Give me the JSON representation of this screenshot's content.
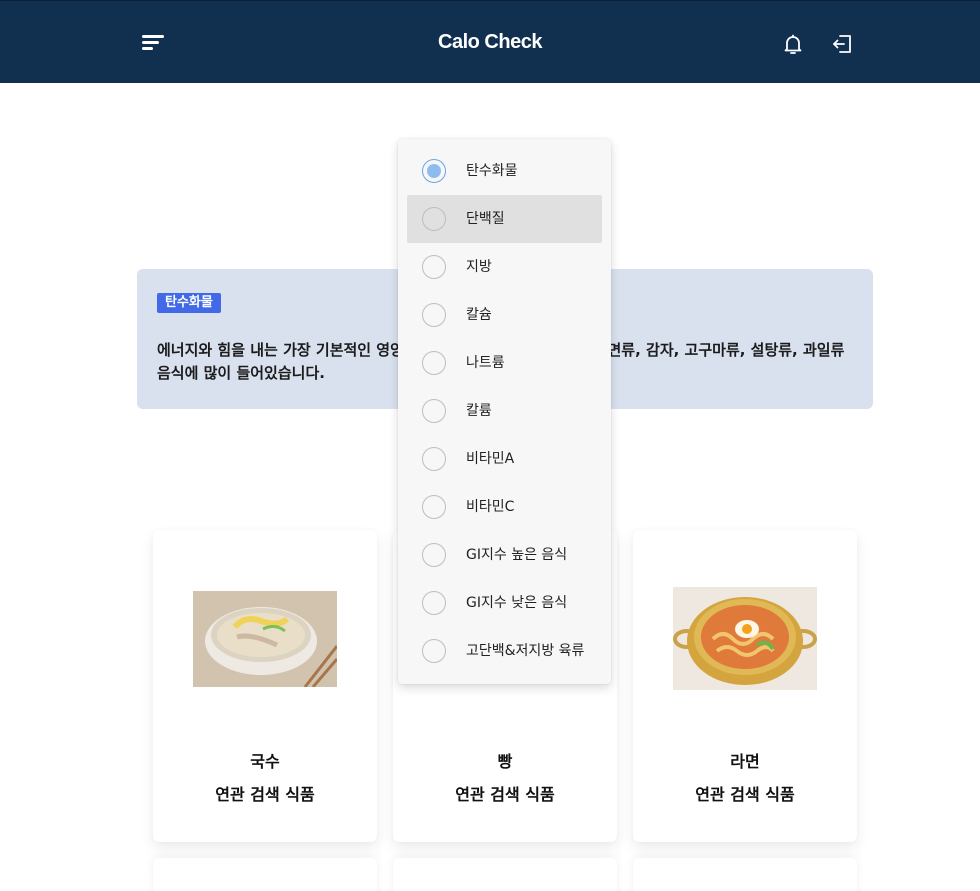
{
  "header": {
    "title": "Calo Check"
  },
  "info": {
    "badge": "탄수화물",
    "text": "에너지와 힘을 내는 가장 기본적인 영양소입니다. 주로 곡식종류, 빵류, 면류, 감자, 고구마류, 설탕류, 과일류 음식에 많이 들어있습니다."
  },
  "cards": [
    {
      "name": "국수",
      "sub": "연관 검색 식품"
    },
    {
      "name": "빵",
      "sub": "연관 검색 식품"
    },
    {
      "name": "라면",
      "sub": "연관 검색 식품"
    }
  ],
  "dropdown": {
    "selected": "탄수화물",
    "hovered": "단백질",
    "options": [
      {
        "label": "탄수화물"
      },
      {
        "label": "단백질"
      },
      {
        "label": "지방"
      },
      {
        "label": "칼슘"
      },
      {
        "label": "나트륨"
      },
      {
        "label": "칼륨"
      },
      {
        "label": "비타민A"
      },
      {
        "label": "비타민C"
      },
      {
        "label": "GI지수 높은 음식"
      },
      {
        "label": "GI지수 낮은 음식"
      },
      {
        "label": "고단백&저지방 육류"
      }
    ]
  },
  "colors": {
    "header": "#11304f",
    "badge": "#4169e8",
    "info_bg": "#d9e1ef",
    "radio_selected": "#8fbcf0"
  },
  "icons": {
    "menu": "menu-icon",
    "bell": "bell-icon",
    "logout": "logout-icon"
  }
}
